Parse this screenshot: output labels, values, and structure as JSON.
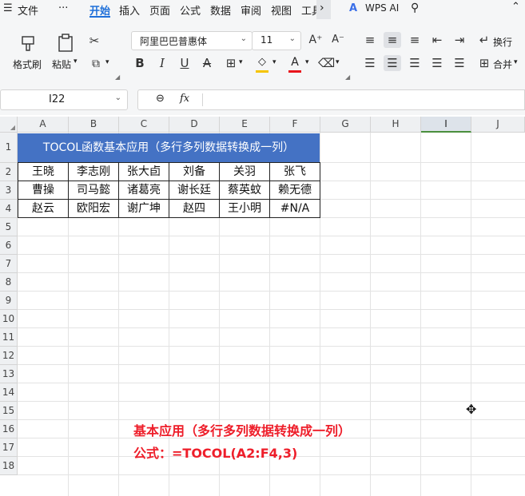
{
  "menu": {
    "file": "文件",
    "more": "···",
    "tabs": [
      "开始",
      "插入",
      "页面",
      "公式",
      "数据",
      "审阅",
      "视图",
      "工具"
    ],
    "active_tab": "开始",
    "wps_ai": "WPS AI"
  },
  "ribbon": {
    "format_painter": "格式刷",
    "paste": "粘贴",
    "font_name": "阿里巴巴普惠体",
    "font_size": "11",
    "wrap": "换行",
    "merge": "合并"
  },
  "formula_bar": {
    "name_box": "I22",
    "fx_label": "fx",
    "formula": ""
  },
  "columns": [
    "A",
    "B",
    "C",
    "D",
    "E",
    "F",
    "G",
    "H",
    "I",
    "J"
  ],
  "selected_column": "I",
  "rows": [
    "1",
    "2",
    "3",
    "4",
    "5",
    "6",
    "7",
    "8",
    "9",
    "10",
    "11",
    "12",
    "13",
    "14",
    "15",
    "16",
    "17",
    "18"
  ],
  "sheet": {
    "title": "TOCOL函数基本应用（多行多列数据转换成一列）",
    "table": [
      [
        "王晓",
        "李志刚",
        "张大卣",
        "刘备",
        "关羽",
        "张飞"
      ],
      [
        "曹操",
        "司马懿",
        "诸葛亮",
        "谢长廷",
        "蔡英蚊",
        "赖无德"
      ],
      [
        "赵云",
        "欧阳宏",
        "谢广坤",
        "赵四",
        "王小明",
        "#N/A"
      ]
    ]
  },
  "annotation": {
    "line1": "基本应用（多行多列数据转换成一列）",
    "line2": "公式：=TOCOL(A2:F4,3)"
  },
  "colors": {
    "accent": "#1e6fd9",
    "title_fill": "#4472c4",
    "note_red": "#ee1e2a",
    "selected_col_underline": "#4a8f3d"
  }
}
